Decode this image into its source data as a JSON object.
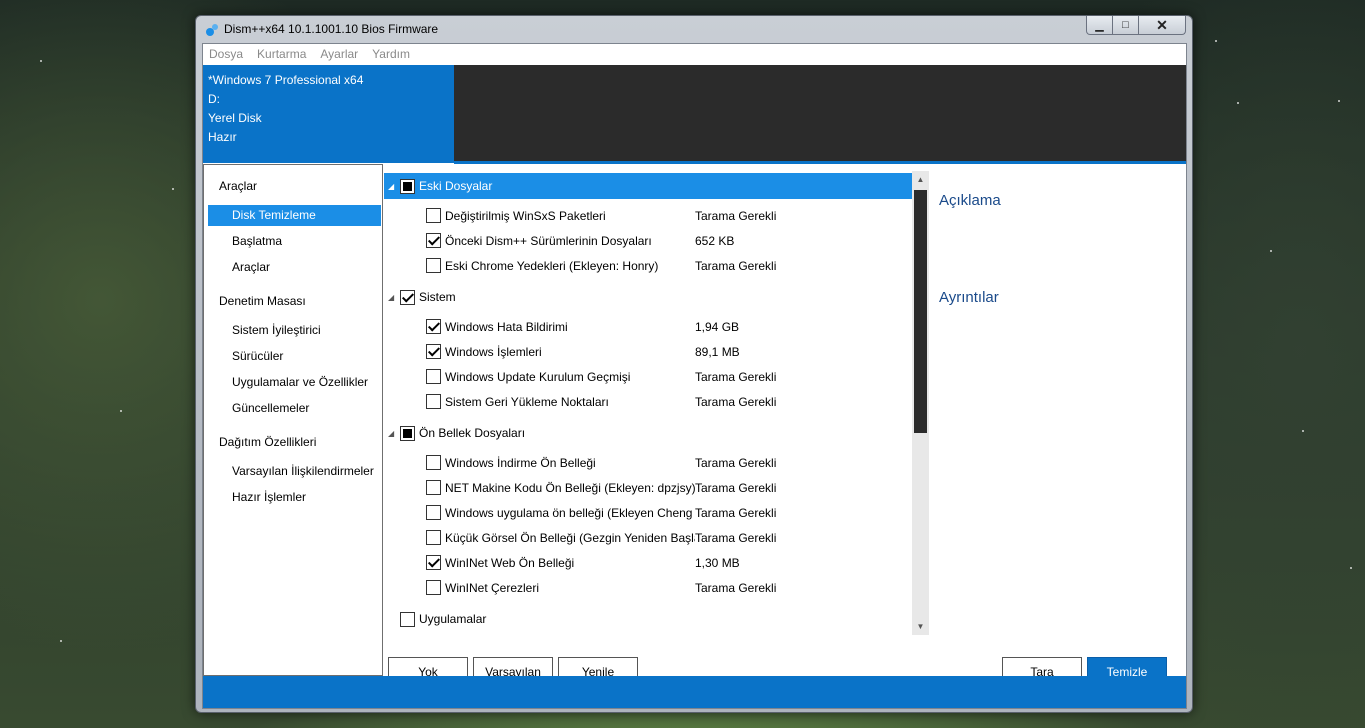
{
  "window": {
    "title": "Dism++x64 10.1.1001.10 Bios Firmware",
    "minimize": "▁",
    "maximize": "□",
    "close": "✕"
  },
  "menu": [
    "Dosya",
    "Kurtarma",
    "Ayarlar",
    "Yardım"
  ],
  "header": {
    "os": "*Windows 7 Professional x64",
    "drive": "D:",
    "disk": "Yerel Disk",
    "status": "Hazır"
  },
  "sidebar": {
    "sections": [
      {
        "label": "Araçlar",
        "items": [
          "Disk Temizleme",
          "Başlatma",
          "Araçlar"
        ]
      },
      {
        "label": "Denetim Masası",
        "items": [
          "Sistem İyileştirici",
          "Sürücüler",
          "Uygulamalar ve Özellikler",
          "Güncellemeler"
        ]
      },
      {
        "label": "Dağıtım Özellikleri",
        "items": [
          "Varsayılan İlişkilendirmeler",
          "Hazır İşlemler"
        ]
      }
    ],
    "active_item": "Disk Temizleme"
  },
  "groups": [
    {
      "label": "Eski Dosyalar",
      "state": "partial",
      "selected": true,
      "items": [
        {
          "name": "Değiştirilmiş WinSxS Paketleri",
          "size": "Tarama Gerekli",
          "checked": false
        },
        {
          "name": "Önceki Dism++ Sürümlerinin Dosyaları",
          "size": "652 KB",
          "checked": true
        },
        {
          "name": "Eski Chrome Yedekleri (Ekleyen: Honry)",
          "size": "Tarama Gerekli",
          "checked": false
        }
      ]
    },
    {
      "label": "Sistem",
      "state": "checked",
      "selected": false,
      "items": [
        {
          "name": "Windows Hata Bildirimi",
          "size": "1,94 GB",
          "checked": true
        },
        {
          "name": "Windows İşlemleri",
          "size": "89,1 MB",
          "checked": true
        },
        {
          "name": "Windows Update Kurulum Geçmişi",
          "size": "Tarama Gerekli",
          "checked": false
        },
        {
          "name": "Sistem Geri Yükleme Noktaları",
          "size": "Tarama Gerekli",
          "checked": false
        }
      ]
    },
    {
      "label": "Ön Bellek Dosyaları",
      "state": "partial",
      "selected": false,
      "items": [
        {
          "name": "Windows İndirme Ön Belleği",
          "size": "Tarama Gerekli",
          "checked": false
        },
        {
          "name": "NET Makine Kodu Ön Belleği (Ekleyen: dpzjsy)",
          "size": "Tarama Gerekli",
          "checked": false
        },
        {
          "name": "Windows uygulama ön belleği (Ekleyen Cheng Ti",
          "size": "Tarama Gerekli",
          "checked": false
        },
        {
          "name": "Küçük Görsel Ön Belleği (Gezgin Yeniden Başlat",
          "size": "Tarama Gerekli",
          "checked": false
        },
        {
          "name": "WinINet Web Ön Belleği",
          "size": "1,30 MB",
          "checked": true
        },
        {
          "name": "WinINet Çerezleri",
          "size": "Tarama Gerekli",
          "checked": false
        }
      ]
    },
    {
      "label": "Uygulamalar",
      "state": "unchecked",
      "selected": false,
      "items": []
    }
  ],
  "right_panel": {
    "description": "Açıklama",
    "details": "Ayrıntılar"
  },
  "buttons": {
    "none": "Yok",
    "defaults": "Varsayılan",
    "refresh": "Yenile",
    "scan": "Tara",
    "clean": "Temizle"
  },
  "colors": {
    "accent": "#0a73c8",
    "selection": "#1b8ee6",
    "header_dark": "#2b2b2b"
  }
}
